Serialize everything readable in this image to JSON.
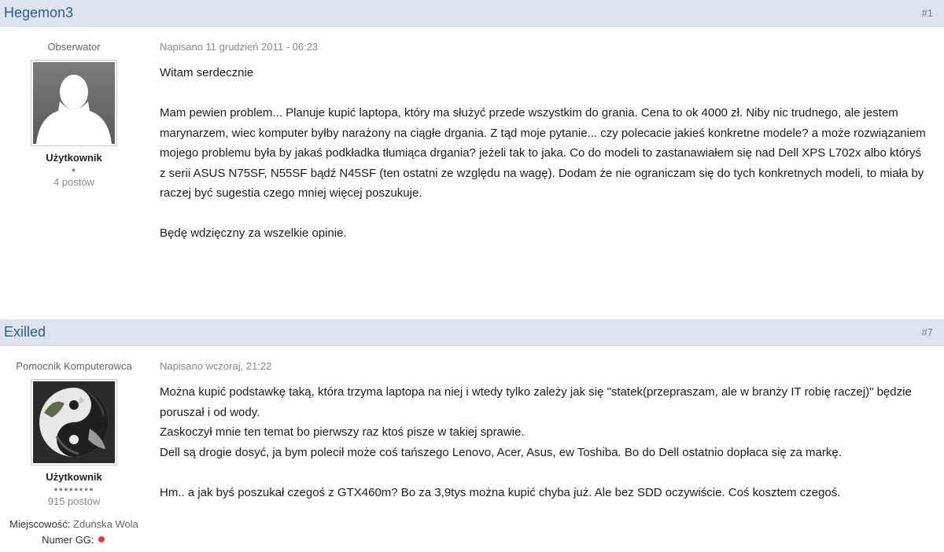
{
  "posts": [
    {
      "author": "Hegemon3",
      "number": "#1",
      "user_title": "Obserwator",
      "group": "Użytkownik",
      "pips": "●",
      "post_count": "4 postów",
      "date": "Napisano 11 grudzień 2011 - 06:23",
      "paragraphs": [
        "Witam serdecznie",
        "Mam pewien problem... Planuje kupić laptopa, który ma służyć przede wszystkim do grania. Cena to ok 4000 zł. Niby nic trudnego, ale jestem marynarzem, wiec komputer byłby narażony na ciągłe drgania. Z tąd moje pytanie... czy polecacie jakieś konkretne modele? a może rozwiązaniem mojego problemu była by jakaś podkładka tłumiąca drgania? jeżeli tak to jaka. Co do modeli to zastanawiałem się nad Dell XPS L702x albo któryś z serii ASUS N75SF, N55SF bądź N45SF (ten ostatni ze względu na wagę). Dodam że nie ograniczam się do tych konkretnych modeli, to miała by raczej być sugestia czego mniej więcej poszukuje.",
        "Będę wdzięczny za wszelkie opinie."
      ],
      "avatar": "default-silhouette"
    },
    {
      "author": "Exilled",
      "number": "#7",
      "user_title": "Pomocnik Komputerowca",
      "group": "Użytkownik",
      "pips": "●●●●●●●●",
      "post_count": "915 postów",
      "location_label": "Miejscowość:",
      "location_value": "Zduńska Wola",
      "gg_label": "Numer GG:",
      "gg_icon": "gg-flower-icon",
      "date": "Napisano wczoraj, 21:22",
      "lines": [
        "Można kupić podstawkę taką, która trzyma laptopa na niej i wtedy tylko zależy jak się \"statek(przepraszam, ale w branży IT robię raczej)\" będzie poruszał i od wody.",
        "Zaskoczył mnie ten temat bo pierwszy raz ktoś pisze w takiej sprawie.",
        "Dell są drogie dosyć, ja bym polecił może coś tańszego Lenovo, Acer, Asus, ew Toshiba. Bo do Dell ostatnio dopłaca się za markę.",
        "Hm.. a jak byś poszukał czegoś z GTX460m? Bo za 3,9tys można kupić chyba już. Ale bez SDD oczywiście. Coś kosztem czegoś."
      ],
      "avatar": "yin-yang-tiger-dragon"
    }
  ],
  "colors": {
    "header_bg": "#dde4ee",
    "author_link": "#2c5d93",
    "muted_text": "#8a8a8a"
  }
}
